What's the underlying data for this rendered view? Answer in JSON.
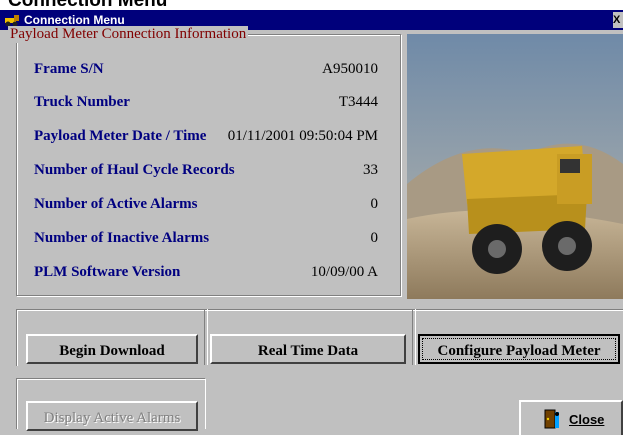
{
  "page_heading": "Connection Menu",
  "window": {
    "title": "Connection Menu",
    "close_glyph": "X",
    "icon": "truck-app-icon"
  },
  "info_group": {
    "title": "Payload Meter Connection Information",
    "rows": [
      {
        "label": "Frame S/N",
        "value": "A950010"
      },
      {
        "label": "Truck Number",
        "value": "T3444"
      },
      {
        "label": "Payload Meter Date / Time",
        "value": "01/11/2001 09:50:04 PM"
      },
      {
        "label": "Number of Haul Cycle Records",
        "value": "33"
      },
      {
        "label": "Number of Active Alarms",
        "value": "0"
      },
      {
        "label": "Number of Inactive Alarms",
        "value": "0"
      },
      {
        "label": "PLM Software Version",
        "value": "10/09/00 A"
      }
    ]
  },
  "photo": {
    "subject": "haul-truck-photo"
  },
  "buttons": {
    "begin_download": "Begin Download",
    "real_time_data": "Real Time Data",
    "configure_payload_meter": "Configure Payload Meter",
    "display_active_alarms": "Display Active Alarms",
    "close": "Close"
  },
  "colors": {
    "titlebar": "#00007b",
    "label_text": "#000080",
    "group_title": "#800000",
    "face": "#c0c0c0"
  }
}
